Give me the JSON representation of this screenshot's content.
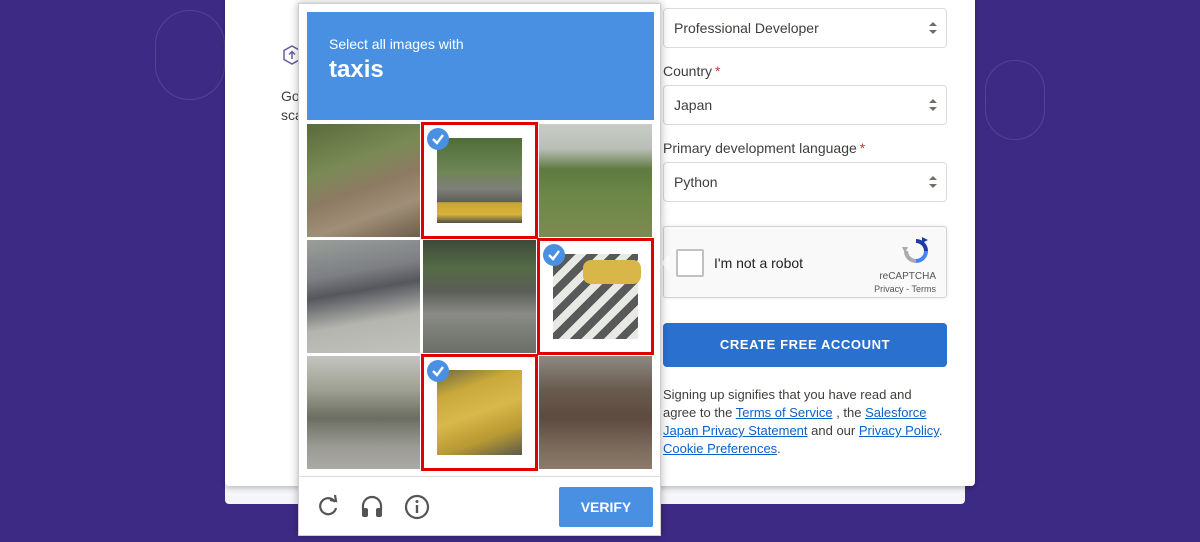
{
  "colors": {
    "background": "#3d2a85",
    "captcha_blue": "#4a90e2",
    "selection_red": "#e00000",
    "primary_button": "#2a70cf",
    "link": "#0b62c9",
    "required": "#c23934"
  },
  "left_panel": {
    "icon": "upload-icon",
    "text_line1": "Go",
    "text_line2": "sca"
  },
  "form": {
    "role_select": {
      "value": "Professional Developer"
    },
    "country": {
      "label": "Country",
      "required_mark": "*",
      "value": "Japan"
    },
    "language": {
      "label": "Primary development language",
      "required_mark": "*",
      "value": "Python"
    },
    "recaptcha": {
      "label": "I'm not a robot",
      "brand": "reCAPTCHA",
      "privacy": "Privacy",
      "separator": " - ",
      "terms": "Terms",
      "checked": false
    },
    "create_button": "CREATE FREE ACCOUNT",
    "legal": {
      "intro": "Signing up signifies that you have read and agree to the ",
      "terms_link": "Terms of Service",
      "mid1": " , the ",
      "privacy_statement_link": "Salesforce Japan Privacy Statement",
      "mid2": " and our ",
      "privacy_policy_link": "Privacy Policy",
      "end": ".",
      "cookie_link": "Cookie Preferences",
      "cookie_end": "."
    }
  },
  "challenge": {
    "instruction": "Select all images with",
    "target": "taxis",
    "tiles": [
      {
        "subject": "overpass railing",
        "selected": false
      },
      {
        "subject": "yellow taxi on street",
        "selected": true
      },
      {
        "subject": "trees and road",
        "selected": false
      },
      {
        "subject": "motorcycles",
        "selected": false
      },
      {
        "subject": "storefront and cars",
        "selected": false
      },
      {
        "subject": "taxi at crosswalk",
        "selected": true
      },
      {
        "subject": "houses",
        "selected": false
      },
      {
        "subject": "yellow taxi door",
        "selected": true
      },
      {
        "subject": "stairs and building",
        "selected": false
      }
    ],
    "footer": {
      "reload_icon": "reload-icon",
      "audio_icon": "headphones-icon",
      "info_icon": "info-icon",
      "verify_label": "VERIFY"
    }
  }
}
